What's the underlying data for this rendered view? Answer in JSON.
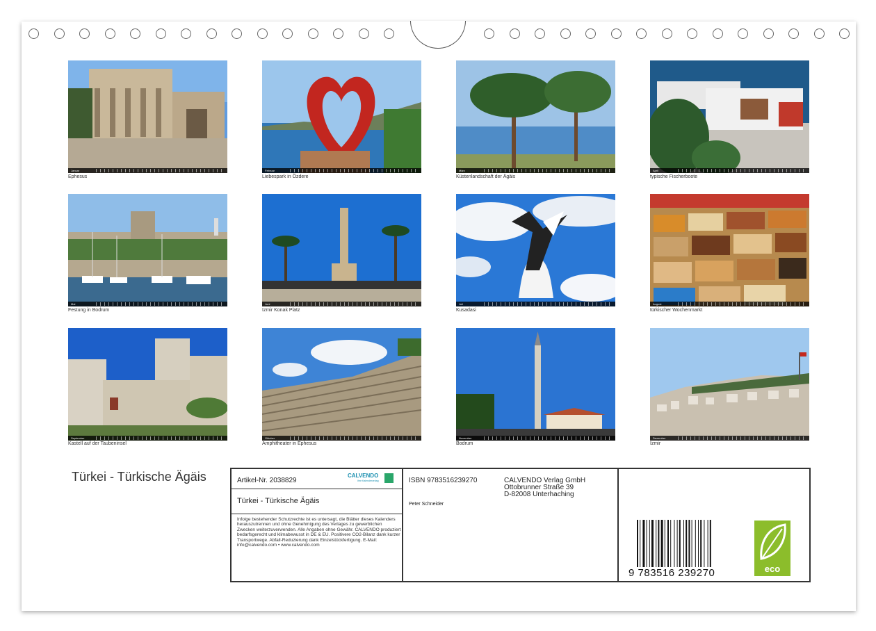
{
  "photos": [
    {
      "caption": "Ephesus",
      "month": "Januar"
    },
    {
      "caption": "Liebespark in Özdere",
      "month": "Februar"
    },
    {
      "caption": "Küstenlandschaft der Ägäis",
      "month": "März"
    },
    {
      "caption": "typische Fischerboote",
      "month": "April"
    },
    {
      "caption": "Festung in Bodrum",
      "month": "Mai"
    },
    {
      "caption": "Izmir Konak Platz",
      "month": "Juni"
    },
    {
      "caption": "Kusadasi",
      "month": "Juli"
    },
    {
      "caption": "türkischer Wochenmarkt",
      "month": "August"
    },
    {
      "caption": "Kastell auf der Taubeninsel",
      "month": "September"
    },
    {
      "caption": "Amphitheater in Ephesus",
      "month": "Oktober"
    },
    {
      "caption": "Bodrum",
      "month": "November"
    },
    {
      "caption": "Izmir",
      "month": "Dezember"
    }
  ],
  "cover": {
    "title": "Türkei - Türkische Ägäis"
  },
  "info": {
    "article": "Artikel-Nr. 2038829",
    "title": "Türkei - Türkische Ägäis",
    "legal": "Infolge bestehender Schutzrechte ist es untersagt, die Blätter dieses Kalenders herauszutrennen und ohne Genehmigung des Verlages zu gewerblichen Zwecken weiterzuverwenden. Alle Angaben ohne Gewähr. CALVENDO produziert bedarfsgerecht und klimabewusst in DE & EU. Positivere CO2-Bilanz dank kurzer Transportwege. Abfall-Reduzierung dank Einzelstückfertigung. E-Mail: info@calvendo.com • www.calvendo.com",
    "isbn": "ISBN 9783516239270",
    "author": "Peter Schneider",
    "publisher_line1": "CALVENDO Verlag GmbH",
    "publisher_line2": "Ottobrunner Straße 39",
    "publisher_line3": "D-82008 Unterhaching",
    "barcode_number": "9  783516  239270",
    "logo_text": "CALVENDO",
    "logo_sub": "Ihre Kalenderverlag",
    "eco_label": "eco"
  },
  "colors": {
    "sky": "#4a8fd6",
    "sea": "#2f77b8",
    "eco_green": "#8cbd2b",
    "calvendo_blue": "#1a8fb0"
  }
}
